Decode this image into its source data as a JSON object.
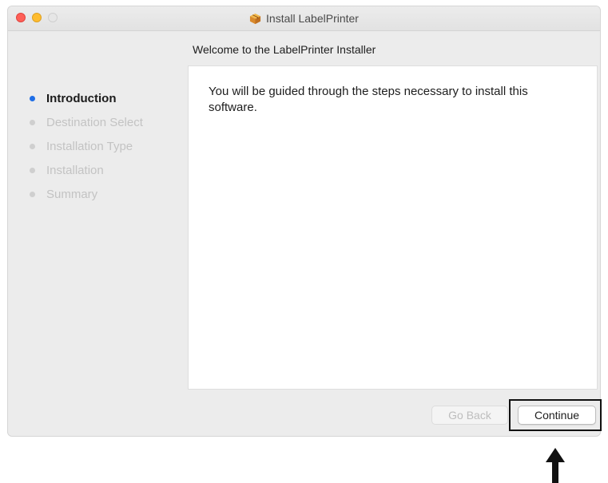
{
  "window": {
    "title": "Install LabelPrinter",
    "title_icon": "package-icon"
  },
  "main": {
    "heading": "Welcome to the LabelPrinter Installer",
    "body_text": "You will be guided through the steps necessary to install this software."
  },
  "sidebar": {
    "steps": [
      {
        "label": "Introduction",
        "active": true
      },
      {
        "label": "Destination Select",
        "active": false
      },
      {
        "label": "Installation Type",
        "active": false
      },
      {
        "label": "Installation",
        "active": false
      },
      {
        "label": "Summary",
        "active": false
      }
    ]
  },
  "buttons": {
    "go_back": "Go Back",
    "continue": "Continue"
  },
  "colors": {
    "active_step_dot": "#1f6ee6",
    "close": "#fe5f57",
    "minimize": "#febc2e",
    "highlight": "#111111"
  },
  "annotation": {
    "icon": "up-arrow-icon"
  }
}
